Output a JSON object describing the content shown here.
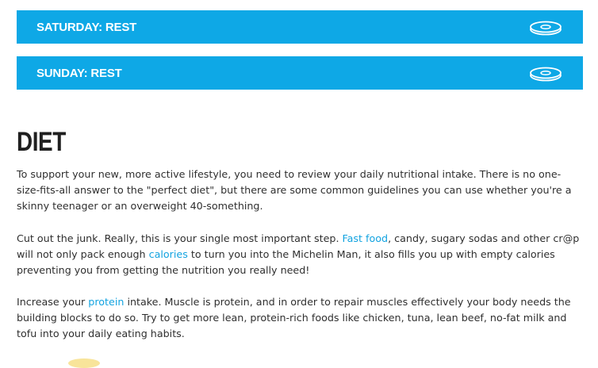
{
  "schedule": [
    {
      "label": "SATURDAY: REST",
      "icon": "weight-plate-icon"
    },
    {
      "label": "SUNDAY: REST",
      "icon": "weight-plate-icon"
    }
  ],
  "diet": {
    "heading": "DIET",
    "p1": "To support your new, more active lifestyle, you need to review your daily nutritional intake. There is no one-size-fits-all answer to the \"perfect diet\", but there are some common guidelines you can use whether you're a skinny teenager or an overweight 40-something.",
    "p2": {
      "t1": "Cut out the junk. Really, this is your single most important step. ",
      "link1": "Fast food",
      "t2": ", candy, sugary sodas and other cr@p will not only pack enough ",
      "link2": "calories",
      "t3": " to turn you into the Michelin Man, it also fills you up with empty calories preventing you from getting the nutrition you really need!"
    },
    "p3": {
      "t1": "Increase your ",
      "link1": "protein",
      "t2": " intake. Muscle is protein, and in order to repair muscles effectively your body needs the building blocks to do so. Try to get more lean, protein-rich foods like chicken, tuna, lean beef, no-fat milk and tofu into your daily eating habits."
    }
  },
  "colors": {
    "accent": "#0ea8e6",
    "link": "#12a3e0"
  }
}
